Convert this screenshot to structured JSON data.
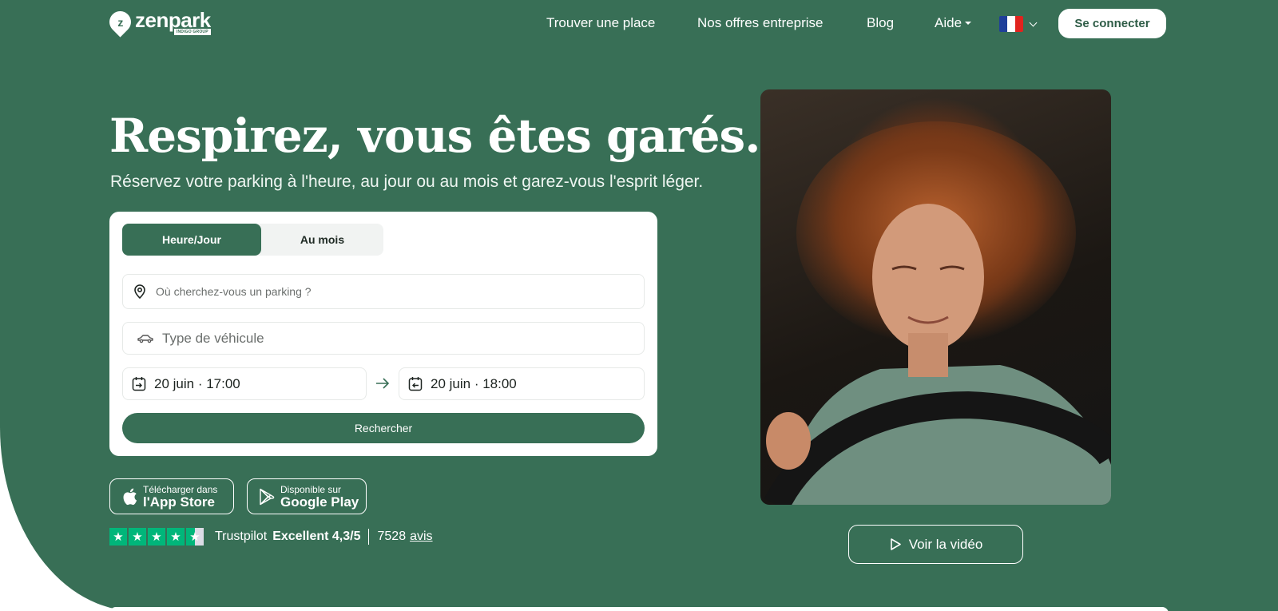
{
  "header": {
    "logo_mark": "z",
    "logo_text": "zenpark",
    "logo_sub": "INDIGO GROUP",
    "nav": [
      {
        "label": "Trouver une place"
      },
      {
        "label": "Nos offres entreprise"
      },
      {
        "label": "Blog"
      },
      {
        "label": "Aide"
      }
    ],
    "language_flag": "fr-flag-icon",
    "login_label": "Se connecter"
  },
  "hero": {
    "title": "Respirez, vous êtes garés.",
    "subtitle": "Réservez votre parking à l'heure, au jour ou au mois et garez-vous l'esprit léger."
  },
  "search": {
    "tabs": [
      {
        "label": "Heure/Jour",
        "active": true
      },
      {
        "label": "Au mois",
        "active": false
      }
    ],
    "where_placeholder": "Où cherchez-vous un parking ?",
    "vehicle_placeholder": "Type de véhicule",
    "start": "20 juin · 17:00",
    "end": "20 juin · 18:00",
    "submit_label": "Rechercher"
  },
  "stores": {
    "apple_small": "Télécharger dans",
    "apple_big": "l'App Store",
    "google_small": "Disponible sur",
    "google_big": "Google Play"
  },
  "trustpilot": {
    "brand": "Trustpilot",
    "rating": "Excellent 4,3/5",
    "count": "7528",
    "link_label": "avis",
    "stars": 4.5
  },
  "video": {
    "label": "Voir la vidéo"
  },
  "colors": {
    "brand_green": "#386f56",
    "trustpilot_green": "#00b67a"
  }
}
